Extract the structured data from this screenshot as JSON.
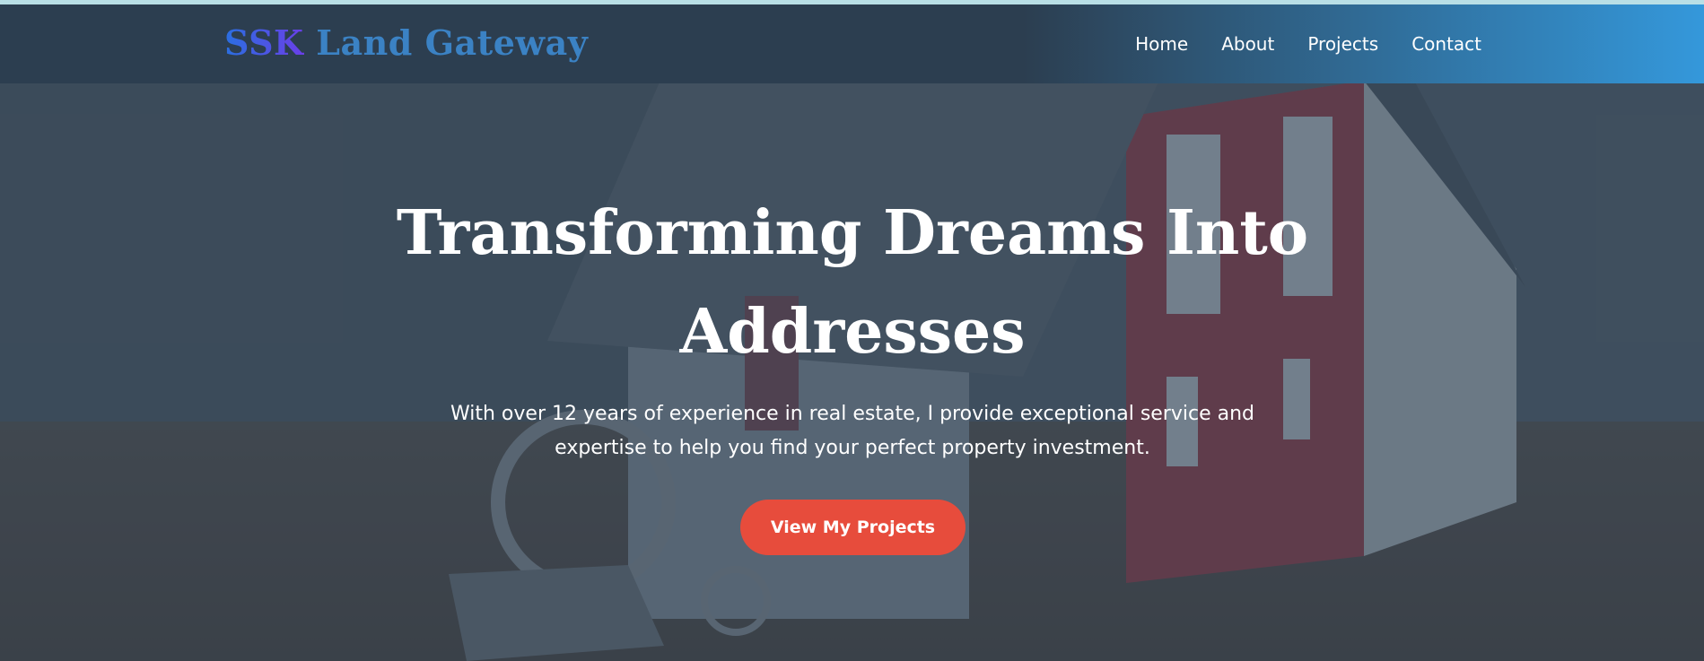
{
  "brand": {
    "logo_part1": "SSK",
    "logo_part2": " Land Gateway"
  },
  "nav": {
    "items": [
      {
        "label": "Home"
      },
      {
        "label": "About"
      },
      {
        "label": "Projects"
      },
      {
        "label": "Contact"
      }
    ]
  },
  "hero": {
    "title": "Transforming Dreams Into Addresses",
    "subtitle": "With over 12 years of experience in real estate, I provide exceptional service and expertise to help you find your perfect property investment.",
    "cta_label": "View My Projects"
  },
  "colors": {
    "navbar_dark": "#2c3e50",
    "navbar_accent": "#3498db",
    "cta": "#e74c3c",
    "text": "#ffffff"
  }
}
